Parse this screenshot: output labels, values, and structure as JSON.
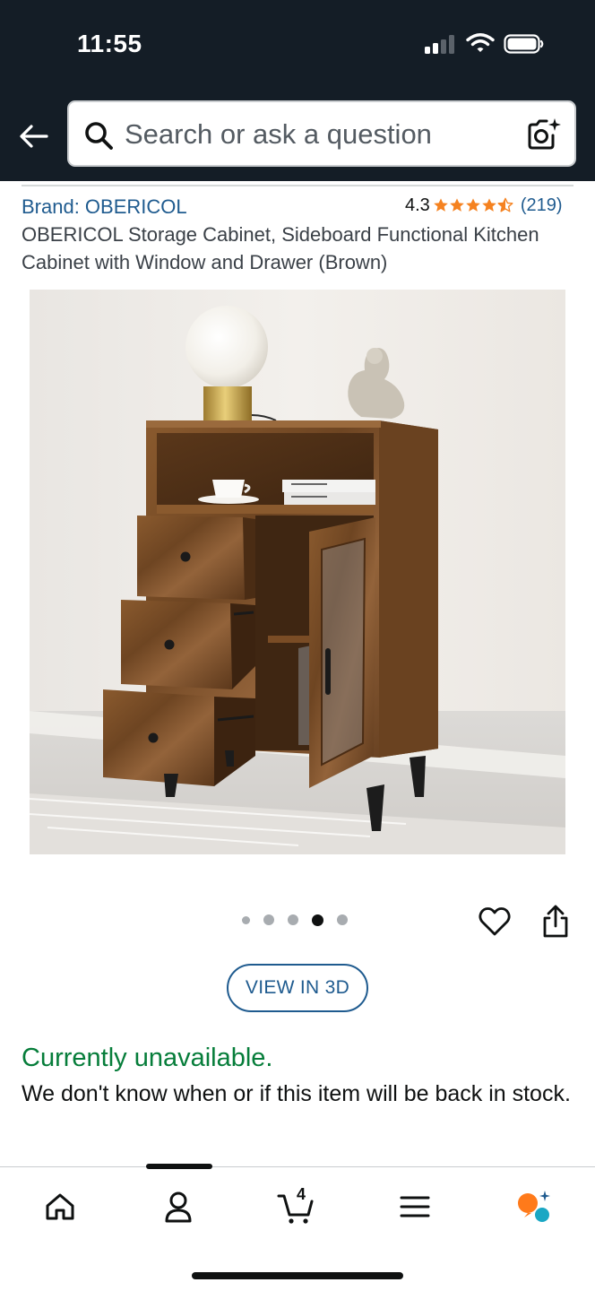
{
  "status_bar": {
    "time": "11:55"
  },
  "header": {
    "search": {
      "placeholder": "Search or ask a question"
    }
  },
  "product": {
    "brand_label": "Brand: OBERICOL",
    "rating": {
      "value": "4.3",
      "stars": 4.5,
      "count": "(219)"
    },
    "title": "OBERICOL Storage Cabinet, Sideboard Functional Kitchen Cabinet with Window and Drawer (Brown)",
    "image_carousel": {
      "total_images": 5,
      "active_index": 3
    },
    "view_3d_label": "VIEW IN 3D",
    "availability": "Currently unavailable.",
    "availability_note": "We don't know when or if this item will be back in stock."
  },
  "bottom_nav": {
    "items": [
      {
        "icon": "home-icon"
      },
      {
        "icon": "account-icon"
      },
      {
        "icon": "cart-icon",
        "badge": "4"
      },
      {
        "icon": "menu-icon"
      },
      {
        "icon": "rufus-assistant-icon"
      }
    ],
    "active_index": 1
  },
  "colors": {
    "header_bg": "#141d26",
    "link": "#1f5b8f",
    "star": "#f58220",
    "availability": "#067d3a",
    "rufus_orange": "#ff7a1a",
    "rufus_teal": "#1aa7c4"
  }
}
